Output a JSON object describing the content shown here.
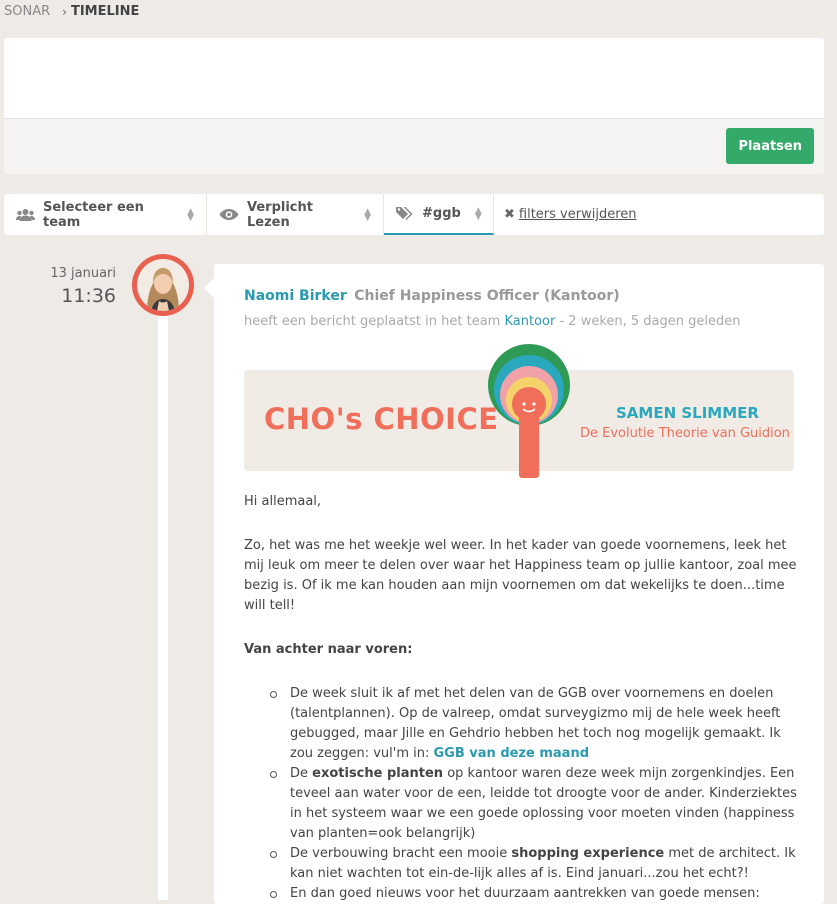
{
  "breadcrumb": {
    "root": "SONAR",
    "current": "TIMELINE"
  },
  "composer": {
    "post_label": "Plaatsen"
  },
  "filters": {
    "team": "Selecteer een team",
    "required": "Verplicht Lezen",
    "tag": "#ggb",
    "clear": "filters verwijderen"
  },
  "post": {
    "date": "13 januari",
    "time": "11:36",
    "author": "Naomi Birker",
    "role": "Chief Happiness Officer (Kantoor)",
    "meta_prefix": "heeft een bericht geplaatst in het team",
    "team": "Kantoor",
    "meta_suffix": "- 2 weken, 5 dagen geleden",
    "banner": {
      "title": "CHO's CHOICE",
      "subtitle1": "SAMEN SLIMMER",
      "subtitle2": "De Evolutie Theorie van Guidion"
    },
    "greeting": "Hi allemaal,",
    "intro": "Zo, het was me het weekje wel weer. In het kader van goede voornemens, leek het mij leuk om meer te delen over waar het Happiness team op jullie kantoor, zoal mee bezig is. Of ik me kan houden aan mijn voornemen om dat wekelijks te doen...time will tell!",
    "heading": "Van achter naar voren:",
    "items": [
      {
        "text1": "De week sluit ik af met het delen van de GGB over voornemens en doelen (talentplannen). Op de valreep, omdat surveygizmo mij de hele week heeft gebugged, maar Jille en Gehdrio hebben het toch nog mogelijk gemaakt. Ik zou zeggen: vul'm in: ",
        "link": "GGB van deze maand"
      },
      {
        "pre": "De ",
        "bold": "exotische planten",
        "post": " op kantoor waren deze week mijn zorgenkindjes. Een teveel aan water voor de een, leidde tot droogte voor de ander. Kinderziektes in het systeem waar we een goede oplossing voor moeten vinden (happiness van planten=ook belangrijk)"
      },
      {
        "pre": "De verbouwing bracht een mooie ",
        "bold": "shopping experience",
        "post": " met de architect. Ik kan niet wachten tot ein-de-lijk alles af is. Eind januari...zou het echt?!"
      },
      {
        "text": "En dan goed nieuws voor het duurzaam aantrekken van goede mensen:"
      }
    ]
  },
  "colors": {
    "accent": "#2a9ab0",
    "post_button": "#34aa6a",
    "avatar_ring": "#e9604f",
    "banner_red": "#f06e5a"
  },
  "icons": [
    "users-icon",
    "eye-icon",
    "tag-icon",
    "sort-icon",
    "close-icon"
  ]
}
